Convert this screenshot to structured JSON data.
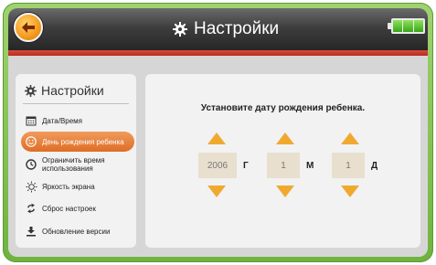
{
  "header": {
    "title": "Настройки",
    "battery_bars": 3,
    "colors": {
      "accent": "#e07a30",
      "stripe": "#c53a2a",
      "frame": "#7fc04f"
    }
  },
  "sidebar": {
    "title": "Настройки",
    "items": [
      {
        "label": "Дата/Время",
        "icon": "calendar-icon",
        "active": false
      },
      {
        "label": "День рождения ребенка",
        "icon": "smiley-icon",
        "active": true
      },
      {
        "label": "Ограничить время использования",
        "icon": "clock-icon",
        "active": false
      },
      {
        "label": "Яркость экрана",
        "icon": "sun-icon",
        "active": false
      },
      {
        "label": "Сброс настроек",
        "icon": "reset-icon",
        "active": false
      },
      {
        "label": "Обновление версии",
        "icon": "download-icon",
        "active": false
      }
    ]
  },
  "main": {
    "prompt": "Установите дату рождения ребенка.",
    "year": {
      "value": "2006",
      "unit": "Г"
    },
    "month": {
      "value": "1",
      "unit": "М"
    },
    "day": {
      "value": "1",
      "unit": "Д"
    }
  }
}
